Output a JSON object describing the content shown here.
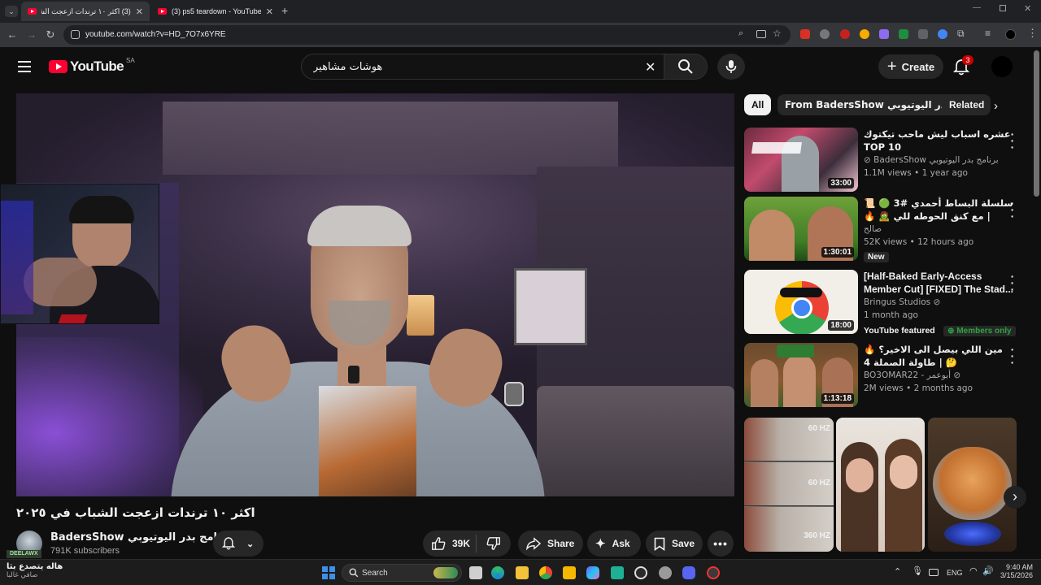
{
  "browser": {
    "tabs": [
      {
        "title": "(3) اكثر ١٠ ترندات ازعجت الشباب في",
        "active": true
      },
      {
        "title": "(3) ps5 teardown - YouTube",
        "active": false
      }
    ],
    "url": "youtube.com/watch?v=HD_7O7x6YRE"
  },
  "header": {
    "logo": "YouTube",
    "country": "SA",
    "search_value": "هوشات مشاهير",
    "create_label": "Create",
    "notification_count": "3"
  },
  "video": {
    "title": "اكثر ١٠ ترندات ازعجت الشباب في ٢٠٢٥",
    "channel_name": "BadersShow برنامج بدر اليوتيوبي",
    "subscribers": "791K subscribers",
    "likes": "39K",
    "share_label": "Share",
    "ask_label": "Ask",
    "save_label": "Save"
  },
  "chips": [
    "All",
    "From BadersShow برنامج بدر اليوتيوبي",
    "Related"
  ],
  "recommendations": [
    {
      "title": "عشره اسباب ليش ماحب تيكتوك TOP 10",
      "channel": "BadersShow برنامج بدر اليوتيوبي",
      "meta": "1.1M views • 1 year ago",
      "duration": "33:00",
      "badge": "",
      "extra": ""
    },
    {
      "title": "سلسلة البساط أحمدي #3 🟢 📜 | مع كنق الحوطه للي 🧟 🔥",
      "channel": "صالح",
      "meta": "52K views • 12 hours ago",
      "duration": "1:30:01",
      "badge": "New",
      "extra": ""
    },
    {
      "title": "[Half-Baked Early-Access Member Cut] [FIXED] The Stad...",
      "channel": "Bringus Studios",
      "meta": "1 month ago",
      "duration": "18:00",
      "badge": "YouTube featured",
      "extra": "Members only"
    },
    {
      "title": "مين اللي بيصل الى الاخير؟ 🔥 🤔 | طاولة الصملة 4",
      "channel": "BO3OMAR22 - أبوعمر",
      "meta": "2M views • 2 months ago",
      "duration": "1:13:18",
      "badge": "",
      "extra": ""
    }
  ],
  "shorts": [
    {
      "labels": [
        "60 HZ",
        "60 HZ",
        "360 HZ"
      ]
    },
    {
      "labels": []
    },
    {
      "labels": []
    }
  ],
  "taskbar": {
    "weather_title": "هاله يتصدع بثا",
    "weather_sub": "صافي غالبا",
    "tray_badge": "DEELAWX",
    "search_label": "Search",
    "language": "ENG",
    "time": "9:40 AM",
    "date": "3/15/2026"
  },
  "colors": {
    "accent": "#ff0033",
    "members_green": "#2ba640",
    "background": "#0f0f0f"
  }
}
